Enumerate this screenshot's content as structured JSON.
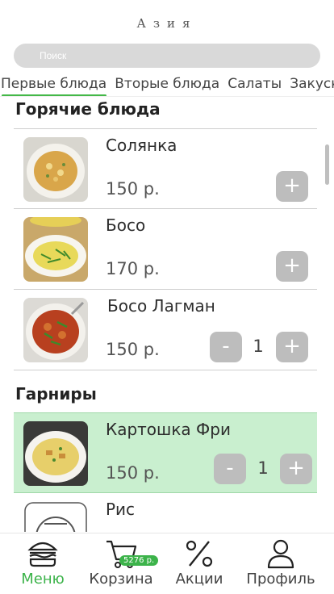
{
  "app": {
    "title": "Азия"
  },
  "search": {
    "placeholder": "Поиск"
  },
  "tabs": [
    "Первые блюда",
    "Вторые блюда",
    "Салаты",
    "Закуски"
  ],
  "sections": [
    {
      "title": "Горячие блюда",
      "items": [
        {
          "name": "Солянка",
          "price": "150 р.",
          "qty": null,
          "add": "+"
        },
        {
          "name": "Босо",
          "price": "170 р.",
          "qty": null,
          "add": "+"
        },
        {
          "name": "Босо Лагман",
          "price": "150 р.",
          "qty": "1",
          "minus": "-",
          "add": "+"
        }
      ]
    },
    {
      "title": "Гарниры",
      "items": [
        {
          "name": "Картошка Фри",
          "price": "150 р.",
          "qty": "1",
          "minus": "-",
          "add": "+"
        },
        {
          "name": "Рис",
          "price": "",
          "qty": null
        }
      ]
    }
  ],
  "nav": {
    "menu": "Меню",
    "cart": "Корзина",
    "cart_badge": "5276 р.",
    "promo": "Акции",
    "profile": "Профиль"
  },
  "colors": {
    "accent": "#3cb34a",
    "selected_bg": "#c9efcf",
    "button": "#bdbdbd"
  }
}
